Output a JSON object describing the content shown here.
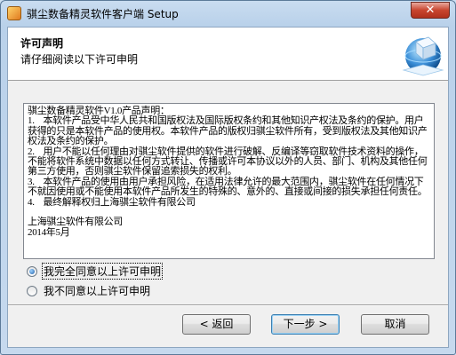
{
  "window": {
    "title": "骐尘数备精灵软件客户端 Setup",
    "close_label": "✕"
  },
  "header": {
    "title": "许可声明",
    "subtitle": "请仔细阅读以下许可申明"
  },
  "license": {
    "text": "骐尘数备精灵软件V1.0产品声明：\n1.    本软件产品受中华人民共和国版权法及国际版权条约和其他知识产权法及条约的保护。用户获得的只是本软件产品的使用权。本软件产品的版权归骐尘软件所有，受到版权法及其他知识产权法及条约的保护。\n2.    用户不能以任何理由对骐尘软件提供的软件进行破解、反编译等窃取软件技术资料的操作，不能将软件系统中数据以任何方式转让、传播或许可本协议以外的人员、部门、机构及其他任何第三方使用，否则骐尘软件保留追索损失的权利。\n3.    本软件产品的使用由用户承担风险，在适用法律允许的最大范围内，骐尘软件在任何情况下不就因使用或不能使用本软件产品所发生的特殊的、意外的、直接或间接的损失承担任何责任。\n4.    最终解释权归上海骐尘软件有限公司\n\n上海骐尘软件有限公司\n2014年5月"
  },
  "options": {
    "agree_label": "我完全同意以上许可申明",
    "disagree_label": "我不同意以上许可申明",
    "selected": "agree"
  },
  "buttons": {
    "back_label": "< 返回",
    "next_label": "下一步 >",
    "cancel_label": "取消"
  }
}
